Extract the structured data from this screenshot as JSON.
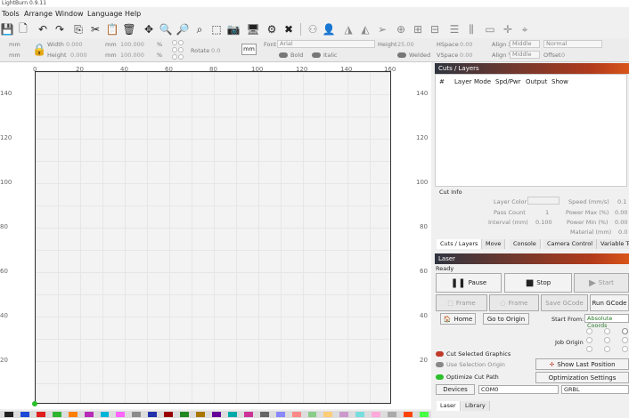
{
  "app": {
    "title": "LightBurn 0.9.11"
  },
  "menu": [
    "Tools",
    "Arrange",
    "Window",
    "Language",
    "Help"
  ],
  "toolbar": {
    "icons": [
      "save-icon",
      "new-file-icon",
      "undo-icon",
      "redo-icon",
      "copy-icon",
      "cut-icon",
      "paste-icon",
      "delete-icon",
      "move-icon",
      "zoom-in-icon",
      "zoom-out-icon",
      "zoom-fit-icon",
      "select-rect-icon",
      "camera-icon",
      "monitor-icon",
      "settings-icon",
      "tools-icon"
    ],
    "right_icons": [
      "group-icon",
      "user-icon",
      "mirror-icon",
      "flip-icon",
      "send-icon",
      "target-icon",
      "align-icon",
      "distribute-icon",
      "align-h-icon",
      "align-v-icon",
      "dock-icon",
      "move-laser-icon"
    ]
  },
  "props": {
    "x_unit": "mm",
    "y_unit": "mm",
    "width_label": "Width",
    "width_value": "0.000",
    "height_label": "Height",
    "height_value": "0.000",
    "w_unit": "mm",
    "h_unit": "mm",
    "scale_w": "100.000",
    "scale_h": "100.000",
    "pct": "%",
    "rotate_label": "Rotate",
    "rotate_value": "0.0",
    "mm_button": "mm",
    "font_label": "Font",
    "font_value": "Arial",
    "font_height_label": "Height",
    "font_height_value": "25.00",
    "hspace_label": "HSpace",
    "hspace_value": "0.00",
    "vspace_label": "VSpace",
    "vspace_value": "0.00",
    "align_x_label": "Align X",
    "align_x_value": "Middle",
    "align_y_label": "Align Y",
    "align_y_value": "Middle",
    "normal_value": "Normal",
    "offset_label": "Offset",
    "offset_value": "0",
    "bold_label": "Bold",
    "italic_label": "Italic",
    "welded_label": "Welded"
  },
  "ruler": {
    "x_ticks": [
      "0",
      "20",
      "40",
      "60",
      "80",
      "100",
      "120",
      "140",
      "160"
    ],
    "y_ticks": [
      "140",
      "120",
      "100",
      "80",
      "60",
      "40",
      "20"
    ],
    "right_y_ticks": [
      "140",
      "120",
      "100",
      "80",
      "60",
      "40",
      "20"
    ]
  },
  "palette": [
    "#222222",
    "#1f4ad6",
    "#e01f1f",
    "#2fb52f",
    "#ff7f00",
    "#b82ab8",
    "#00b5d8",
    "#ff66ff",
    "#8c8c8c",
    "#2233aa",
    "#990000",
    "#228822",
    "#aa7700",
    "#660099",
    "#00aaaa",
    "#cc3399",
    "#666666",
    "#8888ff",
    "#ff8888",
    "#88cc88",
    "#ffcc77",
    "#cc99cc",
    "#77dddd",
    "#ffaadd",
    "#aaaaaa",
    "#ff4400",
    "#44ff44"
  ],
  "cuts_panel": {
    "title": "Cuts / Layers",
    "columns": [
      "#",
      "Layer",
      "Mode",
      "Spd/Pwr",
      "Output",
      "Show"
    ],
    "cut_info_label": "Cut Info",
    "fields": [
      {
        "label": "Layer Color",
        "value": ""
      },
      {
        "label": "Pass Count",
        "value": "1"
      },
      {
        "label": "Interval (mm)",
        "value": "0.100"
      }
    ],
    "right_fields": [
      {
        "label": "Speed (mm/s)",
        "value": "0.1"
      },
      {
        "label": "Power Max (%)",
        "value": "0.00"
      },
      {
        "label": "Power Min (%)",
        "value": "0.00"
      },
      {
        "label": "Material (mm)",
        "value": "0.0"
      }
    ],
    "tabs": [
      "Cuts / Layers",
      "Move",
      "Console",
      "Camera Control",
      "Variable Te"
    ]
  },
  "laser_panel": {
    "title": "Laser",
    "status": "Ready",
    "pause": "Pause",
    "stop": "Stop",
    "start": "Start",
    "frame1": "Frame",
    "frame2": "Frame",
    "save_gcode": "Save GCode",
    "run_gcode": "Run GCode",
    "home": "Home",
    "go_to_origin": "Go to Origin",
    "start_from_label": "Start From:",
    "start_from_value": "Absolute Coords",
    "job_origin_label": "Job Origin",
    "cut_selected": "Cut Selected Graphics",
    "use_selection_origin": "Use Selection Origin",
    "optimize_cut_path": "Optimize Cut Path",
    "show_last_position": "Show Last Position",
    "optimization_settings": "Optimization Settings",
    "devices_button": "Devices",
    "port_value": "COM0",
    "controller_value": "GRBL",
    "tabs": [
      "Laser",
      "Library"
    ]
  },
  "colors": {
    "accent": "#d9551a",
    "toggle_on": "#2bbf2b",
    "toggle_red": "#c0392b"
  }
}
